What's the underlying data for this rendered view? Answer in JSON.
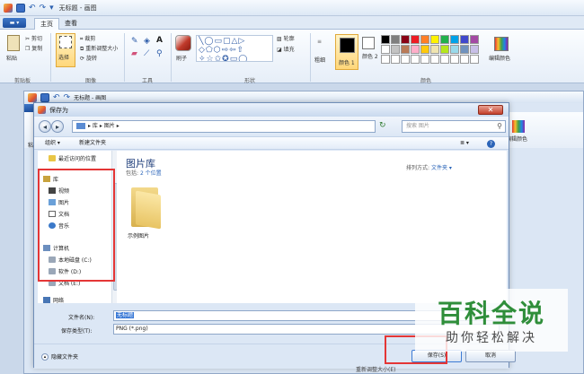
{
  "paint": {
    "window_title": "无标题 - 画图",
    "file_button": "",
    "tabs": [
      "主页",
      "查看"
    ],
    "clipboard": {
      "paste": "粘贴",
      "cut": "剪切",
      "copy": "复制",
      "group": "剪贴板"
    },
    "image": {
      "select": "选择",
      "crop": "裁剪",
      "resize": "重新调整大小",
      "rotate": "旋转",
      "group": "图像"
    },
    "tools_group": "工具",
    "brushes": "刷子",
    "shapes": {
      "outline": "轮廓",
      "fill": "填充",
      "group": "形状"
    },
    "size": "粗细",
    "color1": "颜色 1",
    "color2": "颜色 2",
    "colors_group": "颜色",
    "edit_colors": "编辑颜色",
    "palette_colors": [
      "#000000",
      "#7f7f7f",
      "#880015",
      "#ed1c24",
      "#ff7f27",
      "#fff200",
      "#22b14c",
      "#00a2e8",
      "#3f48cc",
      "#a349a4",
      "#ffffff",
      "#c3c3c3",
      "#b97a57",
      "#ffaec9",
      "#ffc90e",
      "#efe4b0",
      "#b5e61d",
      "#99d9ea",
      "#7092be",
      "#c8bfe7",
      "#ffffff",
      "#ffffff",
      "#ffffff",
      "#ffffff",
      "#ffffff",
      "#ffffff",
      "#ffffff",
      "#ffffff",
      "#ffffff",
      "#ffffff"
    ]
  },
  "mid_window": {
    "title": "无标题 - 画图",
    "paste": "粘",
    "edit_colors": "编辑颜色"
  },
  "dialog": {
    "title": "保存为",
    "close": "✕",
    "address": [
      "库",
      "图片"
    ],
    "search_placeholder": "搜索 图片",
    "organize": "组织 ▾",
    "new_folder": "新建文件夹",
    "views": "≣ ▾",
    "help": "?",
    "nav": {
      "recent": "最近访问的位置",
      "libraries": "库",
      "videos": "视频",
      "pictures": "图片",
      "documents": "文档",
      "music": "音乐",
      "computer": "计算机",
      "local_c": "本地磁盘 (C:)",
      "soft_d": "软件 (D:)",
      "doc_e": "文档 (E:)",
      "network": "网络"
    },
    "library": {
      "title": "图片库",
      "includes": "包括:",
      "locations": "2 个位置",
      "arrange_label": "排列方式:",
      "arrange_value": "文件夹 ▾"
    },
    "folder_name": "示例图片",
    "filename_label": "文件名(N):",
    "filename_value": "无标题",
    "filetype_label": "保存类型(T):",
    "filetype_value": "PNG (*.png)",
    "hide_folders": "隐藏文件夹",
    "save": "保存(S)",
    "cancel": "取消"
  },
  "watermark": {
    "title": "百科全说",
    "subtitle": "助你轻松解决"
  },
  "bottom_strip": "重新调整大小(E)"
}
